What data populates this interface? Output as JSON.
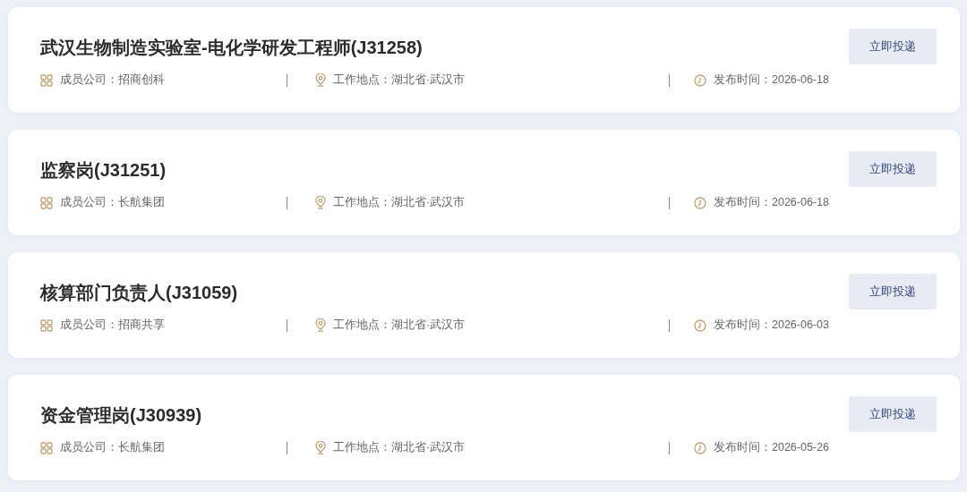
{
  "jobs": [
    {
      "title": "武汉生物制造实验室-电化学研发工程师(J31258)",
      "company": "成员公司：招商创科",
      "location": "工作地点：湖北省·武汉市",
      "date": "发布时间：2026-06-18",
      "button": "立即投递"
    },
    {
      "title": "监察岗(J31251)",
      "company": "成员公司：长航集团",
      "location": "工作地点：湖北省·武汉市",
      "date": "发布时间：2026-06-18",
      "button": "立即投递"
    },
    {
      "title": "核算部门负责人(J31059)",
      "company": "成员公司：招商共享",
      "location": "工作地点：湖北省·武汉市",
      "date": "发布时间：2026-06-03",
      "button": "立即投递"
    },
    {
      "title": "资金管理岗(J30939)",
      "company": "成员公司：长航集团",
      "location": "工作地点：湖北省·武汉市",
      "date": "发布时间：2026-05-26",
      "button": "立即投递"
    }
  ]
}
